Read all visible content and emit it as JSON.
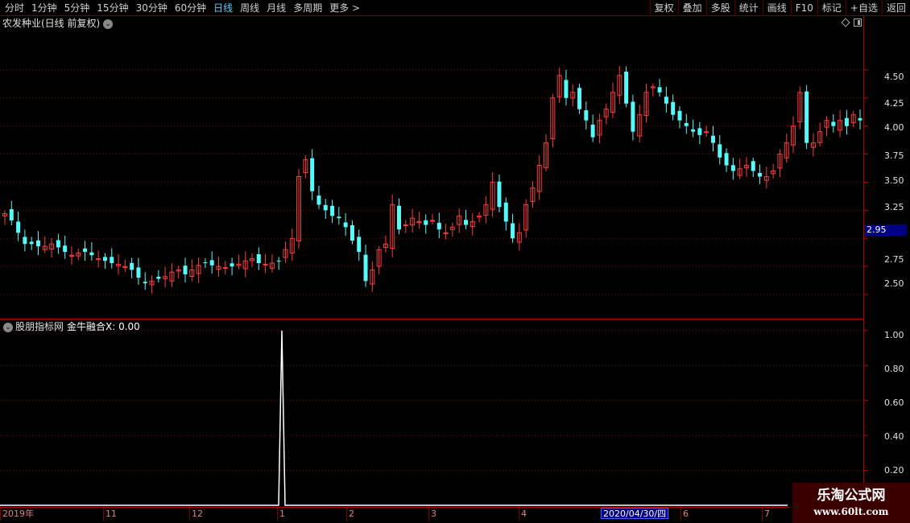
{
  "toolbar": {
    "periods": [
      "分时",
      "1分钟",
      "5分钟",
      "15分钟",
      "30分钟",
      "60分钟",
      "日线",
      "周线",
      "月线",
      "多周期",
      "更多 >"
    ],
    "active_period": "日线",
    "buttons": [
      "复权",
      "叠加",
      "多股",
      "统计",
      "画线",
      "F10",
      "标记",
      "+自选",
      "返回"
    ]
  },
  "main_chart": {
    "title": "农发种业(日线 前复权)",
    "price_ticks": [
      "4.50",
      "4.25",
      "4.00",
      "3.75",
      "3.50",
      "3.25",
      "2.75",
      "2.50"
    ],
    "current_price": "2.95"
  },
  "indicator": {
    "source": "股朋指标网",
    "name_label": "金牛融合X: 0.00",
    "ticks": [
      "1.00",
      "0.80",
      "0.60",
      "0.40",
      "0.20"
    ]
  },
  "date_axis": {
    "labels": [
      "2019年",
      "11",
      "12",
      "1",
      "2",
      "3",
      "4",
      "6",
      "7"
    ],
    "cursor_date": "2020/04/30/四"
  },
  "watermark": {
    "line1": "乐淘公式网",
    "line2": "www.60lt.com"
  },
  "colors": {
    "up": "#ff3c3c",
    "down": "#54fcfc",
    "grid": "#8a0000",
    "axis": "#b00000",
    "active": "#5ad0ff"
  },
  "chart_data": [
    {
      "type": "candlestick",
      "title": "农发种业(日线 前复权)",
      "ylim": [
        2.3,
        4.85
      ],
      "y_ticks": [
        2.5,
        2.75,
        3.0,
        3.25,
        3.5,
        3.75,
        4.0,
        4.25,
        4.5
      ],
      "x_labels": [
        "2019年",
        "11",
        "12",
        "1",
        "2",
        "3",
        "4",
        "2020/04/30/四",
        "6",
        "7"
      ],
      "approx_close_path": [
        3.22,
        3.16,
        3.05,
        2.95,
        2.95,
        2.93,
        2.93,
        2.95,
        2.92,
        2.88,
        2.85,
        2.87,
        2.88,
        2.85,
        2.82,
        2.8,
        2.78,
        2.77,
        2.75,
        2.72,
        2.65,
        2.6,
        2.62,
        2.64,
        2.66,
        2.7,
        2.72,
        2.68,
        2.72,
        2.76,
        2.78,
        2.76,
        2.75,
        2.74,
        2.75,
        2.77,
        2.8,
        2.82,
        2.78,
        2.77,
        2.78,
        2.8,
        2.9,
        3.0,
        3.55,
        3.7,
        3.42,
        3.3,
        3.25,
        3.2,
        3.18,
        3.1,
        2.98,
        2.88,
        2.62,
        2.72,
        2.9,
        2.95,
        3.3,
        3.08,
        3.12,
        3.18,
        3.15,
        3.12,
        3.16,
        3.08,
        3.05,
        3.1,
        3.2,
        3.12,
        3.15,
        3.2,
        3.3,
        3.5,
        3.28,
        3.15,
        3.0,
        3.05,
        3.3,
        3.45,
        3.65,
        3.85,
        4.25,
        4.45,
        4.25,
        4.3,
        4.15,
        4.05,
        3.9,
        4.05,
        4.15,
        4.3,
        4.45,
        4.2,
        3.95,
        4.1,
        4.3,
        4.35,
        4.3,
        4.2,
        4.1,
        4.05,
        4.0,
        3.95,
        3.92,
        3.95,
        3.85,
        3.72,
        3.65,
        3.6,
        3.62,
        3.65,
        3.6,
        3.55,
        3.55,
        3.6,
        3.75,
        3.85,
        4.0,
        4.3,
        3.85,
        3.85,
        3.95,
        4.05,
        4.0,
        4.05,
        4.0,
        4.1,
        4.05
      ]
    },
    {
      "type": "line",
      "title": "金牛融合X: 0.00",
      "ylim": [
        0,
        1.05
      ],
      "y_ticks": [
        0.2,
        0.4,
        0.6,
        0.8,
        1.0
      ],
      "values": [
        0,
        0,
        0,
        0,
        0,
        0,
        1,
        0,
        0,
        0,
        0,
        0,
        0
      ]
    }
  ]
}
